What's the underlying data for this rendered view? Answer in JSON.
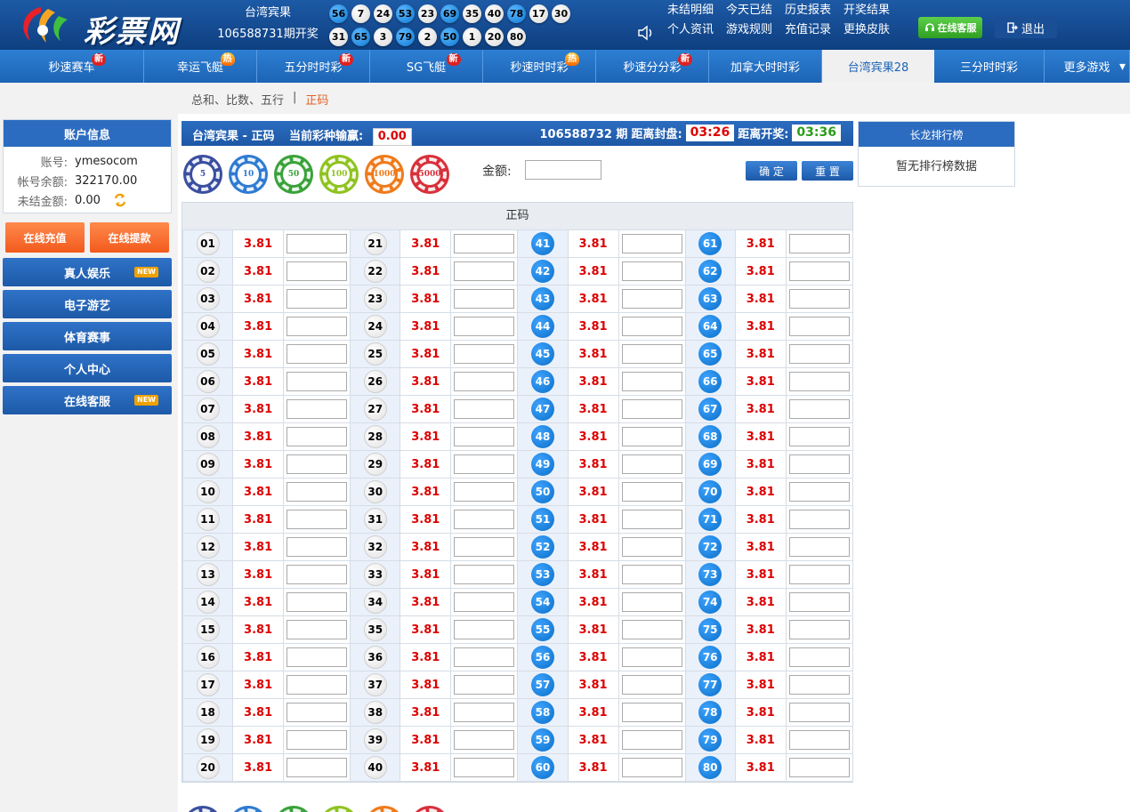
{
  "header": {
    "logo_text": "彩票网",
    "game_name": "台湾宾果",
    "period_text": "106588731期开奖",
    "balls_row1": [
      "56",
      "7",
      "24",
      "53",
      "23",
      "69",
      "35",
      "40",
      "78",
      "17",
      "30"
    ],
    "balls_row2": [
      "31",
      "65",
      "3",
      "79",
      "2",
      "50",
      "1",
      "20",
      "80"
    ],
    "links_row1": [
      "未结明细",
      "今天已结",
      "历史报表",
      "开奖结果"
    ],
    "links_row2": [
      "个人资讯",
      "游戏规则",
      "充值记录",
      "更换皮肤"
    ],
    "service_label": "在线客服",
    "logout_label": "退出"
  },
  "game_nav": [
    {
      "label": "秒速赛车",
      "badge": "新",
      "badge_type": "new"
    },
    {
      "label": "幸运飞艇",
      "badge": "热",
      "badge_type": "hot"
    },
    {
      "label": "五分时时彩",
      "badge": "新",
      "badge_type": "new"
    },
    {
      "label": "SG飞艇",
      "badge": "新",
      "badge_type": "new"
    },
    {
      "label": "秒速时时彩",
      "badge": "热",
      "badge_type": "hot"
    },
    {
      "label": "秒速分分彩",
      "badge": "新",
      "badge_type": "new"
    },
    {
      "label": "加拿大时时彩",
      "badge": "",
      "badge_type": ""
    },
    {
      "label": "台湾宾果28",
      "badge": "",
      "badge_type": "",
      "active": true
    },
    {
      "label": "三分时时彩",
      "badge": "",
      "badge_type": ""
    },
    {
      "label": "更多游戏",
      "badge": "",
      "badge_type": ""
    }
  ],
  "sub_nav": {
    "item1": "总和、比数、五行",
    "sep": "|",
    "current": "正码"
  },
  "account": {
    "title": "账户信息",
    "account_label": "账号:",
    "account_value": "ymesocom",
    "balance_label": "帐号余额:",
    "balance_value": "322170.00",
    "unsettled_label": "未结金额:",
    "unsettled_value": "0.00"
  },
  "side_buttons": {
    "recharge": "在线充值",
    "withdraw": "在线提款"
  },
  "menu": [
    {
      "label": "真人娱乐",
      "tag": "NEW"
    },
    {
      "label": "电子游艺",
      "tag": ""
    },
    {
      "label": "体育赛事",
      "tag": ""
    },
    {
      "label": "个人中心",
      "tag": ""
    },
    {
      "label": "在线客服",
      "tag": "NEW"
    }
  ],
  "title_bar": {
    "game": "台湾宾果 - 正码",
    "winloss_label": "当前彩种输赢:",
    "winloss_value": "0.00",
    "period": "106588732 期",
    "close_label": "距离封盘:",
    "close_time": "03:26",
    "draw_label": "距离开奖:",
    "draw_time": "03:36"
  },
  "chips": [
    {
      "label": "5",
      "color": "#3a4fa0"
    },
    {
      "label": "10",
      "color": "#2f7bd2"
    },
    {
      "label": "50",
      "color": "#3aa23a"
    },
    {
      "label": "100",
      "color": "#8fc320"
    },
    {
      "label": "1000",
      "color": "#f07a1a"
    },
    {
      "label": "5000",
      "color": "#d8303a"
    }
  ],
  "controls": {
    "amount_label": "金额:",
    "confirm": "确 定",
    "reset": "重 置"
  },
  "rank": {
    "title": "长龙排行榜",
    "empty": "暂无排行榜数据"
  },
  "table": {
    "header": "正码",
    "odds": "3.81",
    "columns": [
      {
        "start": 1,
        "style": "white"
      },
      {
        "start": 21,
        "style": "white"
      },
      {
        "start": 41,
        "style": "blue"
      },
      {
        "start": 61,
        "style": "blue"
      }
    ],
    "rows": 20
  }
}
